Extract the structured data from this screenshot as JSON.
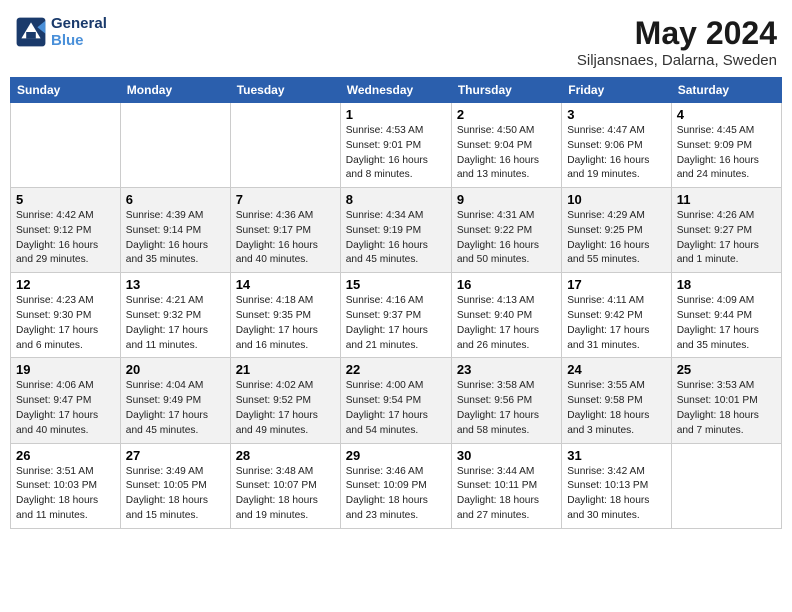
{
  "header": {
    "logo_line1": "General",
    "logo_line2": "Blue",
    "month_year": "May 2024",
    "location": "Siljansnaes, Dalarna, Sweden"
  },
  "days_of_week": [
    "Sunday",
    "Monday",
    "Tuesday",
    "Wednesday",
    "Thursday",
    "Friday",
    "Saturday"
  ],
  "weeks": [
    {
      "alt": false,
      "days": [
        {
          "num": "",
          "info": ""
        },
        {
          "num": "",
          "info": ""
        },
        {
          "num": "",
          "info": ""
        },
        {
          "num": "1",
          "info": "Sunrise: 4:53 AM\nSunset: 9:01 PM\nDaylight: 16 hours\nand 8 minutes."
        },
        {
          "num": "2",
          "info": "Sunrise: 4:50 AM\nSunset: 9:04 PM\nDaylight: 16 hours\nand 13 minutes."
        },
        {
          "num": "3",
          "info": "Sunrise: 4:47 AM\nSunset: 9:06 PM\nDaylight: 16 hours\nand 19 minutes."
        },
        {
          "num": "4",
          "info": "Sunrise: 4:45 AM\nSunset: 9:09 PM\nDaylight: 16 hours\nand 24 minutes."
        }
      ]
    },
    {
      "alt": true,
      "days": [
        {
          "num": "5",
          "info": "Sunrise: 4:42 AM\nSunset: 9:12 PM\nDaylight: 16 hours\nand 29 minutes."
        },
        {
          "num": "6",
          "info": "Sunrise: 4:39 AM\nSunset: 9:14 PM\nDaylight: 16 hours\nand 35 minutes."
        },
        {
          "num": "7",
          "info": "Sunrise: 4:36 AM\nSunset: 9:17 PM\nDaylight: 16 hours\nand 40 minutes."
        },
        {
          "num": "8",
          "info": "Sunrise: 4:34 AM\nSunset: 9:19 PM\nDaylight: 16 hours\nand 45 minutes."
        },
        {
          "num": "9",
          "info": "Sunrise: 4:31 AM\nSunset: 9:22 PM\nDaylight: 16 hours\nand 50 minutes."
        },
        {
          "num": "10",
          "info": "Sunrise: 4:29 AM\nSunset: 9:25 PM\nDaylight: 16 hours\nand 55 minutes."
        },
        {
          "num": "11",
          "info": "Sunrise: 4:26 AM\nSunset: 9:27 PM\nDaylight: 17 hours\nand 1 minute."
        }
      ]
    },
    {
      "alt": false,
      "days": [
        {
          "num": "12",
          "info": "Sunrise: 4:23 AM\nSunset: 9:30 PM\nDaylight: 17 hours\nand 6 minutes."
        },
        {
          "num": "13",
          "info": "Sunrise: 4:21 AM\nSunset: 9:32 PM\nDaylight: 17 hours\nand 11 minutes."
        },
        {
          "num": "14",
          "info": "Sunrise: 4:18 AM\nSunset: 9:35 PM\nDaylight: 17 hours\nand 16 minutes."
        },
        {
          "num": "15",
          "info": "Sunrise: 4:16 AM\nSunset: 9:37 PM\nDaylight: 17 hours\nand 21 minutes."
        },
        {
          "num": "16",
          "info": "Sunrise: 4:13 AM\nSunset: 9:40 PM\nDaylight: 17 hours\nand 26 minutes."
        },
        {
          "num": "17",
          "info": "Sunrise: 4:11 AM\nSunset: 9:42 PM\nDaylight: 17 hours\nand 31 minutes."
        },
        {
          "num": "18",
          "info": "Sunrise: 4:09 AM\nSunset: 9:44 PM\nDaylight: 17 hours\nand 35 minutes."
        }
      ]
    },
    {
      "alt": true,
      "days": [
        {
          "num": "19",
          "info": "Sunrise: 4:06 AM\nSunset: 9:47 PM\nDaylight: 17 hours\nand 40 minutes."
        },
        {
          "num": "20",
          "info": "Sunrise: 4:04 AM\nSunset: 9:49 PM\nDaylight: 17 hours\nand 45 minutes."
        },
        {
          "num": "21",
          "info": "Sunrise: 4:02 AM\nSunset: 9:52 PM\nDaylight: 17 hours\nand 49 minutes."
        },
        {
          "num": "22",
          "info": "Sunrise: 4:00 AM\nSunset: 9:54 PM\nDaylight: 17 hours\nand 54 minutes."
        },
        {
          "num": "23",
          "info": "Sunrise: 3:58 AM\nSunset: 9:56 PM\nDaylight: 17 hours\nand 58 minutes."
        },
        {
          "num": "24",
          "info": "Sunrise: 3:55 AM\nSunset: 9:58 PM\nDaylight: 18 hours\nand 3 minutes."
        },
        {
          "num": "25",
          "info": "Sunrise: 3:53 AM\nSunset: 10:01 PM\nDaylight: 18 hours\nand 7 minutes."
        }
      ]
    },
    {
      "alt": false,
      "days": [
        {
          "num": "26",
          "info": "Sunrise: 3:51 AM\nSunset: 10:03 PM\nDaylight: 18 hours\nand 11 minutes."
        },
        {
          "num": "27",
          "info": "Sunrise: 3:49 AM\nSunset: 10:05 PM\nDaylight: 18 hours\nand 15 minutes."
        },
        {
          "num": "28",
          "info": "Sunrise: 3:48 AM\nSunset: 10:07 PM\nDaylight: 18 hours\nand 19 minutes."
        },
        {
          "num": "29",
          "info": "Sunrise: 3:46 AM\nSunset: 10:09 PM\nDaylight: 18 hours\nand 23 minutes."
        },
        {
          "num": "30",
          "info": "Sunrise: 3:44 AM\nSunset: 10:11 PM\nDaylight: 18 hours\nand 27 minutes."
        },
        {
          "num": "31",
          "info": "Sunrise: 3:42 AM\nSunset: 10:13 PM\nDaylight: 18 hours\nand 30 minutes."
        },
        {
          "num": "",
          "info": ""
        }
      ]
    }
  ]
}
